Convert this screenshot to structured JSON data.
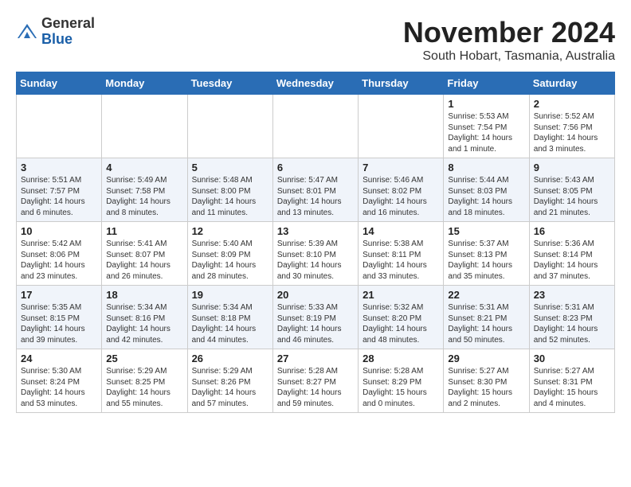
{
  "header": {
    "logo_general": "General",
    "logo_blue": "Blue",
    "month_title": "November 2024",
    "location": "South Hobart, Tasmania, Australia"
  },
  "days_of_week": [
    "Sunday",
    "Monday",
    "Tuesday",
    "Wednesday",
    "Thursday",
    "Friday",
    "Saturday"
  ],
  "weeks": [
    [
      {
        "day": "",
        "info": ""
      },
      {
        "day": "",
        "info": ""
      },
      {
        "day": "",
        "info": ""
      },
      {
        "day": "",
        "info": ""
      },
      {
        "day": "",
        "info": ""
      },
      {
        "day": "1",
        "info": "Sunrise: 5:53 AM\nSunset: 7:54 PM\nDaylight: 14 hours\nand 1 minute."
      },
      {
        "day": "2",
        "info": "Sunrise: 5:52 AM\nSunset: 7:56 PM\nDaylight: 14 hours\nand 3 minutes."
      }
    ],
    [
      {
        "day": "3",
        "info": "Sunrise: 5:51 AM\nSunset: 7:57 PM\nDaylight: 14 hours\nand 6 minutes."
      },
      {
        "day": "4",
        "info": "Sunrise: 5:49 AM\nSunset: 7:58 PM\nDaylight: 14 hours\nand 8 minutes."
      },
      {
        "day": "5",
        "info": "Sunrise: 5:48 AM\nSunset: 8:00 PM\nDaylight: 14 hours\nand 11 minutes."
      },
      {
        "day": "6",
        "info": "Sunrise: 5:47 AM\nSunset: 8:01 PM\nDaylight: 14 hours\nand 13 minutes."
      },
      {
        "day": "7",
        "info": "Sunrise: 5:46 AM\nSunset: 8:02 PM\nDaylight: 14 hours\nand 16 minutes."
      },
      {
        "day": "8",
        "info": "Sunrise: 5:44 AM\nSunset: 8:03 PM\nDaylight: 14 hours\nand 18 minutes."
      },
      {
        "day": "9",
        "info": "Sunrise: 5:43 AM\nSunset: 8:05 PM\nDaylight: 14 hours\nand 21 minutes."
      }
    ],
    [
      {
        "day": "10",
        "info": "Sunrise: 5:42 AM\nSunset: 8:06 PM\nDaylight: 14 hours\nand 23 minutes."
      },
      {
        "day": "11",
        "info": "Sunrise: 5:41 AM\nSunset: 8:07 PM\nDaylight: 14 hours\nand 26 minutes."
      },
      {
        "day": "12",
        "info": "Sunrise: 5:40 AM\nSunset: 8:09 PM\nDaylight: 14 hours\nand 28 minutes."
      },
      {
        "day": "13",
        "info": "Sunrise: 5:39 AM\nSunset: 8:10 PM\nDaylight: 14 hours\nand 30 minutes."
      },
      {
        "day": "14",
        "info": "Sunrise: 5:38 AM\nSunset: 8:11 PM\nDaylight: 14 hours\nand 33 minutes."
      },
      {
        "day": "15",
        "info": "Sunrise: 5:37 AM\nSunset: 8:13 PM\nDaylight: 14 hours\nand 35 minutes."
      },
      {
        "day": "16",
        "info": "Sunrise: 5:36 AM\nSunset: 8:14 PM\nDaylight: 14 hours\nand 37 minutes."
      }
    ],
    [
      {
        "day": "17",
        "info": "Sunrise: 5:35 AM\nSunset: 8:15 PM\nDaylight: 14 hours\nand 39 minutes."
      },
      {
        "day": "18",
        "info": "Sunrise: 5:34 AM\nSunset: 8:16 PM\nDaylight: 14 hours\nand 42 minutes."
      },
      {
        "day": "19",
        "info": "Sunrise: 5:34 AM\nSunset: 8:18 PM\nDaylight: 14 hours\nand 44 minutes."
      },
      {
        "day": "20",
        "info": "Sunrise: 5:33 AM\nSunset: 8:19 PM\nDaylight: 14 hours\nand 46 minutes."
      },
      {
        "day": "21",
        "info": "Sunrise: 5:32 AM\nSunset: 8:20 PM\nDaylight: 14 hours\nand 48 minutes."
      },
      {
        "day": "22",
        "info": "Sunrise: 5:31 AM\nSunset: 8:21 PM\nDaylight: 14 hours\nand 50 minutes."
      },
      {
        "day": "23",
        "info": "Sunrise: 5:31 AM\nSunset: 8:23 PM\nDaylight: 14 hours\nand 52 minutes."
      }
    ],
    [
      {
        "day": "24",
        "info": "Sunrise: 5:30 AM\nSunset: 8:24 PM\nDaylight: 14 hours\nand 53 minutes."
      },
      {
        "day": "25",
        "info": "Sunrise: 5:29 AM\nSunset: 8:25 PM\nDaylight: 14 hours\nand 55 minutes."
      },
      {
        "day": "26",
        "info": "Sunrise: 5:29 AM\nSunset: 8:26 PM\nDaylight: 14 hours\nand 57 minutes."
      },
      {
        "day": "27",
        "info": "Sunrise: 5:28 AM\nSunset: 8:27 PM\nDaylight: 14 hours\nand 59 minutes."
      },
      {
        "day": "28",
        "info": "Sunrise: 5:28 AM\nSunset: 8:29 PM\nDaylight: 15 hours\nand 0 minutes."
      },
      {
        "day": "29",
        "info": "Sunrise: 5:27 AM\nSunset: 8:30 PM\nDaylight: 15 hours\nand 2 minutes."
      },
      {
        "day": "30",
        "info": "Sunrise: 5:27 AM\nSunset: 8:31 PM\nDaylight: 15 hours\nand 4 minutes."
      }
    ]
  ]
}
